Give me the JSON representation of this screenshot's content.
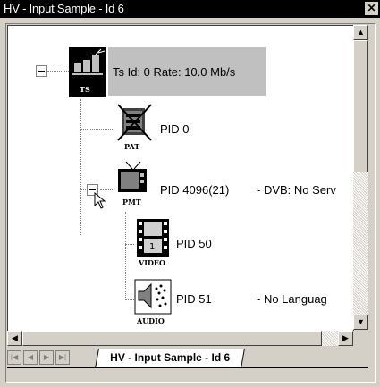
{
  "window": {
    "title": "HV - Input Sample - Id 6",
    "close_glyph": "✕"
  },
  "tree": {
    "ts": {
      "caption": "TS",
      "label": "Ts Id: 0 Rate: 10.0 Mb/s",
      "icon": "transport-stream-icon"
    },
    "pat": {
      "caption": "PAT",
      "label": "PID 0",
      "icon": "pat-icon"
    },
    "pmt": {
      "caption": "PMT",
      "label": "PID 4096(21)",
      "detail": "- DVB: No Serv",
      "icon": "pmt-tv-icon"
    },
    "video": {
      "caption": "VIDEO",
      "label": "PID 50",
      "icon": "video-film-icon"
    },
    "audio": {
      "caption": "AUDIO",
      "label": "PID 51",
      "detail": "- No Languag",
      "icon": "audio-speaker-icon"
    }
  },
  "tabs": [
    {
      "label": "HV - Input Sample - Id 6",
      "active": true
    }
  ],
  "colors": {
    "title_bg": "#000000",
    "selection_bg": "#c0c0c0",
    "face": "#d4d0c8"
  }
}
